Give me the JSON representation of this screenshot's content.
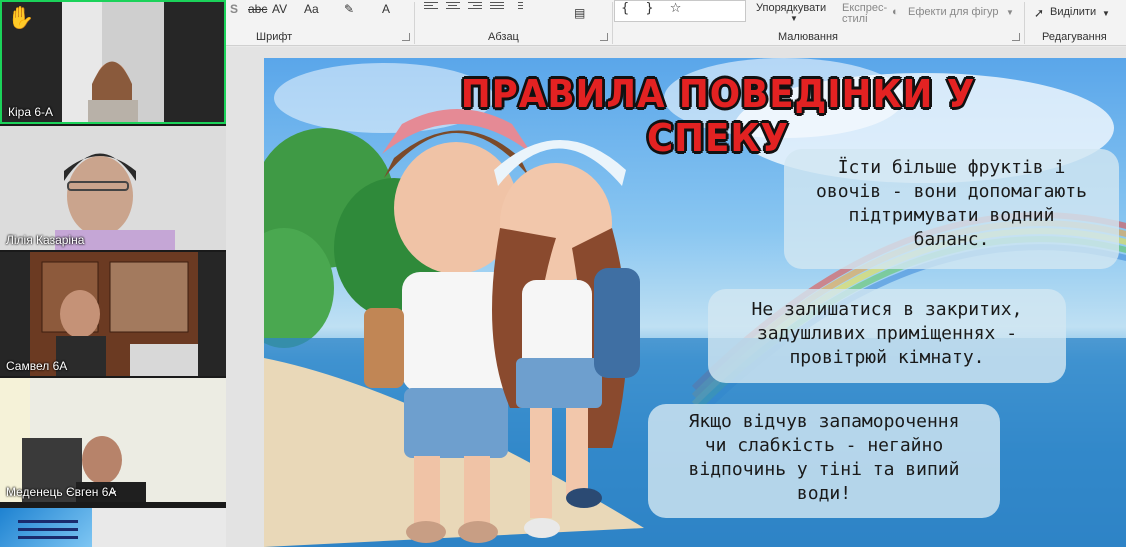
{
  "gallery": {
    "participants": [
      {
        "name": "Кіра 6-А",
        "raised_hand": true
      },
      {
        "name": "Лілія Казаріна"
      },
      {
        "name": "Самвел 6А"
      },
      {
        "name": "Меденець Євген 6А"
      }
    ]
  },
  "ribbon": {
    "groups": {
      "font": "Шрифт",
      "paragraph": "Абзац",
      "drawing": "Малювання",
      "editing": "Редагування"
    },
    "arrange_label": "Упорядкувати",
    "quick_styles_label_1": "Експрес-",
    "quick_styles_label_2": "стилі",
    "shape_effects_label": "Ефекти для фігур",
    "select_label": "Виділити",
    "font_glyphs": {
      "s": "S",
      "abc": "abc",
      "av": "AV",
      "aa": "Aa",
      "a": "A"
    },
    "shape_glyphs": "{ } ☆"
  },
  "slide": {
    "title": "ПРАВИЛА ПОВЕДІНКИ У СПЕКУ",
    "cards": [
      {
        "lines": [
          "Їсти більше фруктів і",
          "овочів - вони допомагають",
          "підтримувати водний",
          "баланс."
        ]
      },
      {
        "lines": [
          "Не залишатися в закритих,",
          "задушливих приміщеннях -",
          "провітрюй кімнату."
        ]
      },
      {
        "lines": [
          "Якщо відчув запаморочення",
          "чи слабкість - негайно",
          "відпочинь у тіні та випий",
          "води!"
        ]
      }
    ]
  },
  "colors": {
    "active_speaker_border": "#1bd25a",
    "title_red": "#e32222",
    "card_bg": "#d2e6f2"
  }
}
